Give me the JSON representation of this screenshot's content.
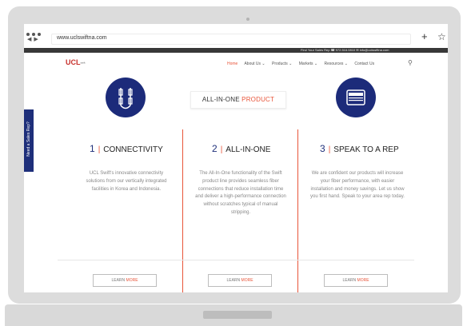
{
  "browser": {
    "url": "www.uclswiftna.com",
    "back_arrow": "◀",
    "forward_arrow": "▶",
    "new_tab": "+",
    "bookmark": "☆"
  },
  "topbar": {
    "text": "Find Your Sales Rep  ☎ 972.516.0810   ✉ info@uclswiftna.com"
  },
  "header": {
    "logo": "UCL",
    "logo_sub": "swift",
    "nav": {
      "home": "Home",
      "about": "About Us ⌄",
      "products": "Products ⌄",
      "markets": "Markets ⌄",
      "resources": "Resources ⌄",
      "contact": "Contact Us"
    }
  },
  "sidetab": {
    "label": "Need a Sales Rep?"
  },
  "hero": {
    "headline_main": "ALL-IN-ONE ",
    "headline_accent": "PRODUCT"
  },
  "columns": [
    {
      "number": "1",
      "title": "CONNECTIVITY",
      "body": "UCL Swift's innovative connectivity solutions from our vertically integrated facilities in Korea and Indonesia."
    },
    {
      "number": "2",
      "title": "ALL-IN-ONE",
      "body": "The All-In-One functionality of the Swift product line provides seamless fiber connections that reduce installation time and deliver a high-performance connection without scratches typical of manual stripping."
    },
    {
      "number": "3",
      "title": "SPEAK TO A REP",
      "body": "We are confident our products will increase your fiber performance, with easier installation and money savings. Let us show you first hand. Speak to your area rep today."
    }
  ],
  "learn_more": {
    "learn": "LEARN ",
    "more": "MORE"
  },
  "colors": {
    "navy": "#1c2b7a",
    "accent": "#e8553a",
    "topbar": "#383838"
  }
}
